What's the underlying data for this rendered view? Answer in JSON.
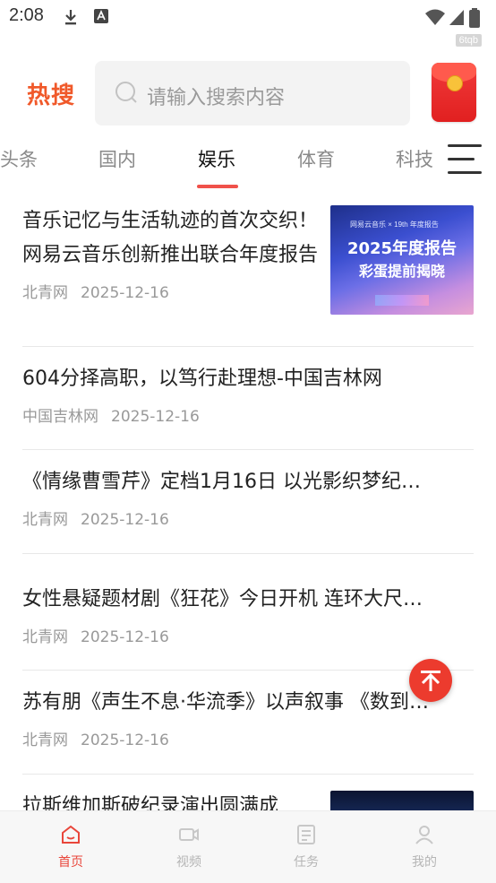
{
  "status_bar": {
    "time": "2:08",
    "badge": "6tqb"
  },
  "header": {
    "logo": "热搜",
    "search_placeholder": "请输入搜索内容"
  },
  "tabs": [
    {
      "label": "头条"
    },
    {
      "label": "国内"
    },
    {
      "label": "娱乐",
      "active": true
    },
    {
      "label": "体育"
    },
    {
      "label": "科技"
    }
  ],
  "feed": [
    {
      "title": "音乐记忆与生活轨迹的首次交织！网易云音乐创新推出联合年度报告",
      "source": "北青网",
      "date": "2025-12-16",
      "thumb": {
        "top_text": "网易云音乐 × 19th 年度报告",
        "main_text": "2025年度报告",
        "sub_text": "彩蛋提前揭晓"
      }
    },
    {
      "title": "604分择高职，以笃行赴理想-中国吉林网",
      "source": "中国吉林网",
      "date": "2025-12-16"
    },
    {
      "title": "《情缘曹雪芹》定档1月16日 以光影织梦纪…",
      "source": "北青网",
      "date": "2025-12-16"
    },
    {
      "title": "女性悬疑题材剧《狂花》今日开机 连环大尺…",
      "source": "北青网",
      "date": "2025-12-16"
    },
    {
      "title": "苏有朋《声生不息·华流季》以声叙事 《数到…",
      "source": "北青网",
      "date": "2025-12-16"
    },
    {
      "title": "拉斯维加斯破纪录演出圆满成"
    }
  ],
  "bottom_nav": [
    {
      "label": "首页",
      "icon": "home-icon",
      "active": true
    },
    {
      "label": "视频",
      "icon": "video-icon"
    },
    {
      "label": "任务",
      "icon": "task-icon"
    },
    {
      "label": "我的",
      "icon": "profile-icon"
    }
  ],
  "colors": {
    "accent": "#f0514a",
    "logo": "#f0592a",
    "to_top_button": "#ec3b2e"
  }
}
